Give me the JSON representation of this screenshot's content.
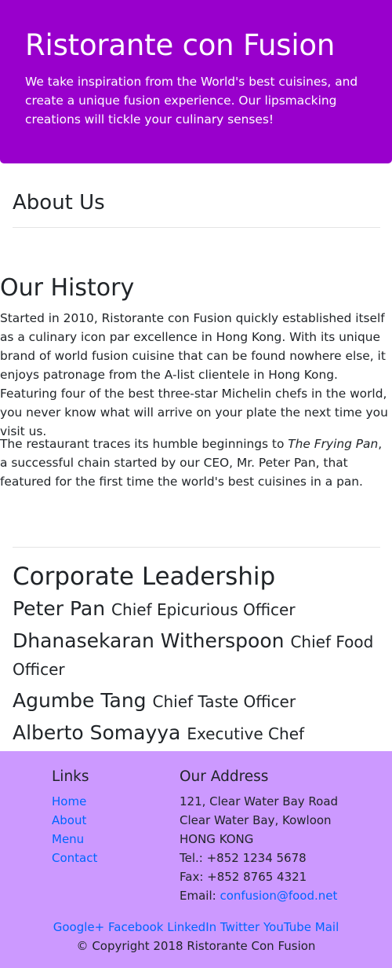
{
  "jumbotron": {
    "title": "Ristorante con Fusion",
    "tagline": "We take inspiration from the World's best cuisines, and create a unique fusion experience. Our lipsmacking creations will tickle your culinary senses!"
  },
  "about": {
    "heading": "About Us"
  },
  "history": {
    "heading": "Our History",
    "p1": "Started in 2010, Ristorante con Fusion quickly established itself as a culinary icon par excellence in Hong Kong. With its unique brand of world fusion cuisine that can be found nowhere else, it enjoys patronage from the A-list clientele in Hong Kong. Featuring four of the best three-star Michelin chefs in the world, you never know what will arrive on your plate the next time you visit us.",
    "p2_before": "The restaurant traces its humble beginnings to ",
    "p2_italic": "The Frying Pan",
    "p2_after": ", a successful chain started by our CEO, Mr. Peter Pan, that featured for the first time the world's best cuisines in a pan."
  },
  "leadership": {
    "heading": "Corporate Leadership",
    "leaders": [
      {
        "name": "Peter Pan",
        "role": "Chief Epicurious Officer"
      },
      {
        "name": "Dhanasekaran Witherspoon",
        "role": "Chief Food Officer"
      },
      {
        "name": "Agumbe Tang",
        "role": "Chief Taste Officer"
      },
      {
        "name": "Alberto Somayya",
        "role": "Executive Chef"
      }
    ]
  },
  "footer": {
    "links_heading": "Links",
    "links": [
      "Home",
      "About",
      "Menu",
      "Contact"
    ],
    "address_heading": "Our Address",
    "address_lines": [
      "121, Clear Water Bay Road",
      "Clear Water Bay, Kowloon",
      "HONG KONG",
      "Tel.: +852 1234 5678",
      "Fax: +852 8765 4321"
    ],
    "email_label": "Email: ",
    "email": "confusion@food.net",
    "social": [
      "Google+",
      "Facebook",
      "LinkedIn",
      "Twitter",
      "YouTube",
      "Mail"
    ],
    "copyright": "© Copyright 2018 Ristorante Con Fusion"
  },
  "colors": {
    "jumbotron_bg": "#9900cc",
    "footer_bg": "#cc99ff",
    "link": "#0066ff",
    "text": "#212529"
  }
}
